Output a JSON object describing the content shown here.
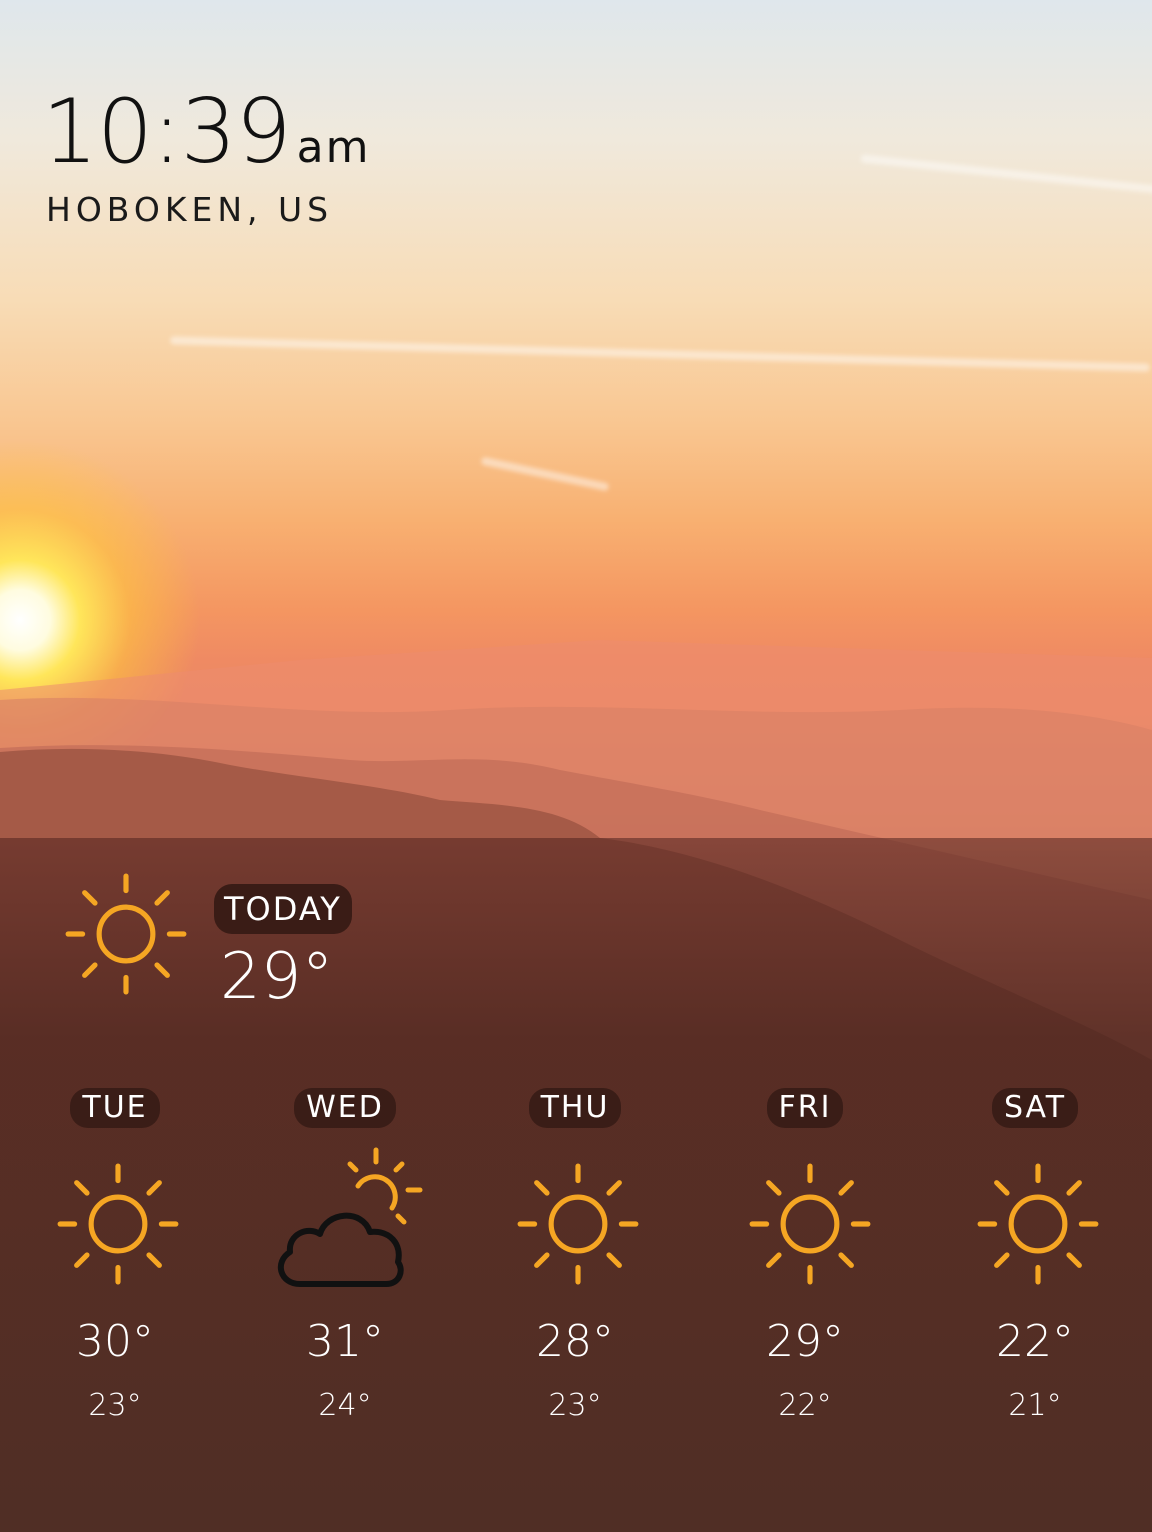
{
  "clock": {
    "time": "10:39",
    "ampm": "am",
    "location": "HOBOKEN, US"
  },
  "today": {
    "label": "TODAY",
    "temp": "29°",
    "icon": "sun-icon"
  },
  "forecast": [
    {
      "day": "TUE",
      "icon": "sun-icon",
      "high": "30°",
      "low": "23°"
    },
    {
      "day": "WED",
      "icon": "partly-cloudy-icon",
      "high": "31°",
      "low": "24°"
    },
    {
      "day": "THU",
      "icon": "sun-icon",
      "high": "28°",
      "low": "23°"
    },
    {
      "day": "FRI",
      "icon": "sun-icon",
      "high": "29°",
      "low": "22°"
    },
    {
      "day": "SAT",
      "icon": "sun-icon",
      "high": "22°",
      "low": "21°"
    }
  ],
  "colors": {
    "sun": "#f5a623",
    "pill": "#3a1d17",
    "panel": "#4a2a22"
  }
}
